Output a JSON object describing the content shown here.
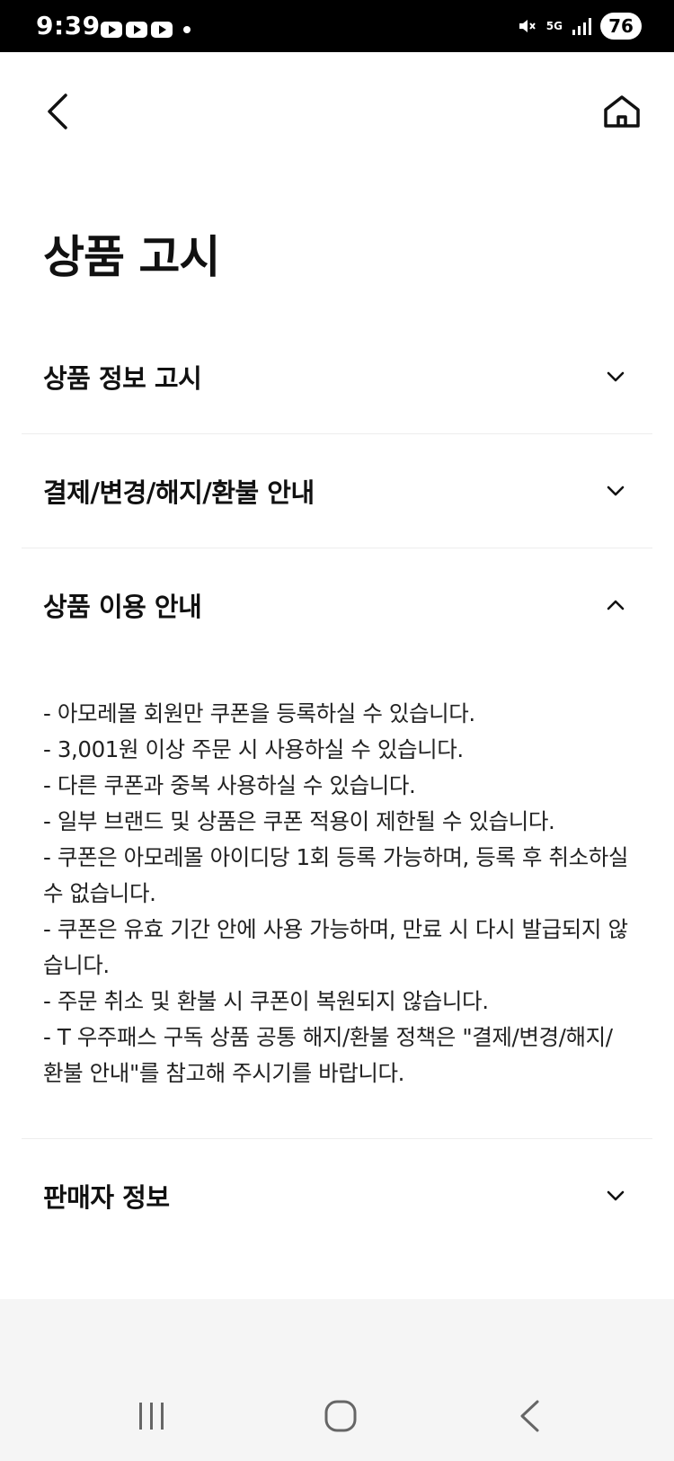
{
  "status_bar": {
    "time": "9:39",
    "network": "5G",
    "battery": "76",
    "icons": [
      "youtube-icon",
      "youtube-icon",
      "youtube-icon",
      "notification-dot-icon",
      "mute-icon",
      "5g-icon",
      "signal-icon"
    ]
  },
  "top_bar": {
    "back_icon": "chevron-left-icon",
    "home_icon": "home-icon"
  },
  "page": {
    "title": "상품 고시"
  },
  "sections": [
    {
      "title": "상품 정보 고시",
      "expanded": false
    },
    {
      "title": "결제/변경/해지/환불 안내",
      "expanded": false
    },
    {
      "title": "상품 이용 안내",
      "expanded": true,
      "lines": [
        "- 아모레몰 회원만 쿠폰을 등록하실 수 있습니다.",
        "- 3,001원 이상 주문 시 사용하실 수 있습니다.",
        "- 다른 쿠폰과 중복 사용하실 수 있습니다.",
        "- 일부 브랜드 및 상품은 쿠폰 적용이 제한될 수 있습니다.",
        "- 쿠폰은 아모레몰 아이디당 1회 등록 가능하며, 등록 후 취소하실 수 없습니다.",
        "- 쿠폰은 유효 기간 안에 사용 가능하며, 만료 시 다시 발급되지 않습니다.",
        "- 주문 취소 및 환불 시 쿠폰이 복원되지 않습니다.",
        "- T 우주패스 구독 상품 공통 해지/환불 정책은 \"결제/변경/해지/환불 안내\"를 참고해 주시기를 바랍니다."
      ]
    },
    {
      "title": "판매자 정보",
      "expanded": false
    }
  ],
  "nav_bar": {
    "icons": [
      "recent-apps-icon",
      "home-circle-icon",
      "back-chevron-icon"
    ]
  },
  "colors": {
    "text": "#111111",
    "divider": "#ededed",
    "footer_bg": "#f5f5f5",
    "status_bg": "#000000"
  }
}
